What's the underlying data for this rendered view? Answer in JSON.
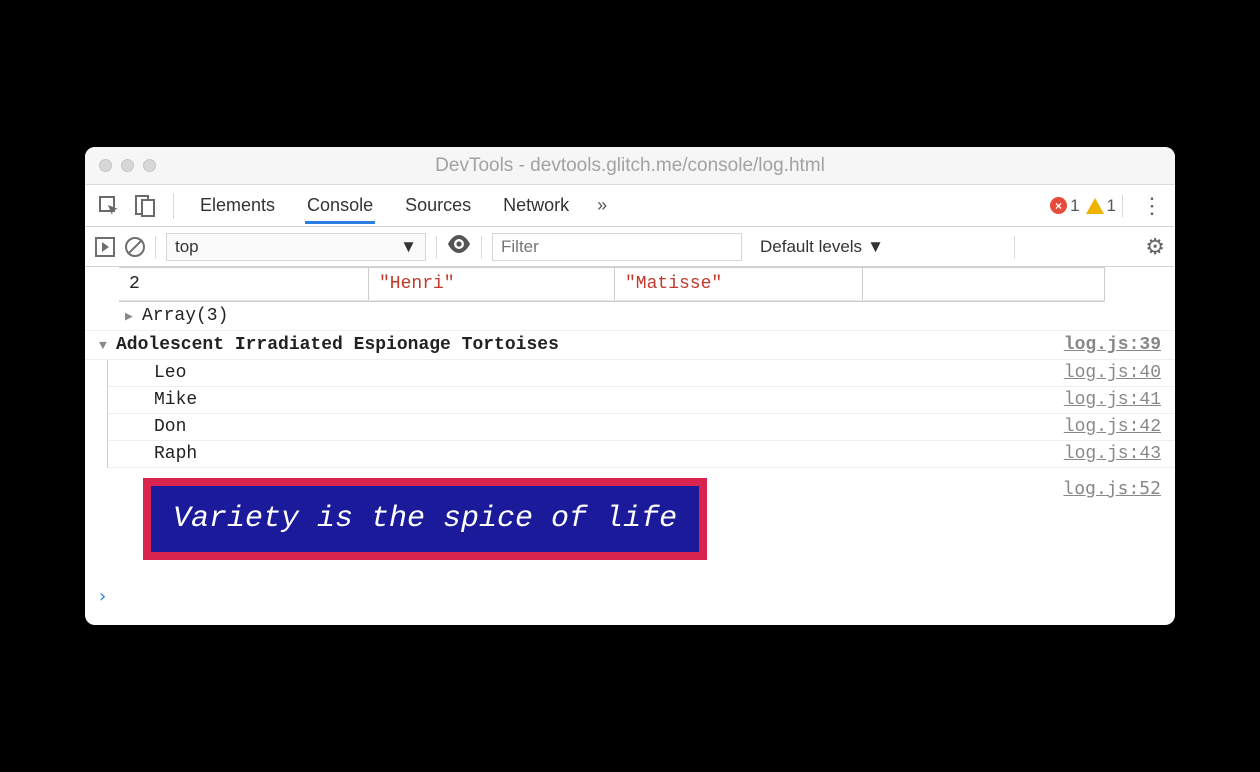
{
  "window": {
    "title": "DevTools - devtools.glitch.me/console/log.html"
  },
  "tabs": {
    "items": [
      "Elements",
      "Console",
      "Sources",
      "Network"
    ],
    "active_index": 1,
    "error_count": "1",
    "warn_count": "1"
  },
  "toolbar": {
    "context": "top",
    "filter_placeholder": "Filter",
    "levels_label": "Default levels"
  },
  "tableRow": {
    "index": "2",
    "first": "\"Henri\"",
    "last": "\"Matisse\""
  },
  "array_preview": "Array(3)",
  "group": {
    "title": "Adolescent Irradiated Espionage Tortoises",
    "src": "log.js:39",
    "items": [
      {
        "label": "Leo",
        "src": "log.js:40"
      },
      {
        "label": "Mike",
        "src": "log.js:41"
      },
      {
        "label": "Don",
        "src": "log.js:42"
      },
      {
        "label": "Raph",
        "src": "log.js:43"
      }
    ]
  },
  "styled": {
    "text": "Variety is the spice of life",
    "src": "log.js:52"
  },
  "prompt_symbol": "›",
  "colors": {
    "styled_bg": "#1a1a9a",
    "styled_border": "#d9244f"
  }
}
